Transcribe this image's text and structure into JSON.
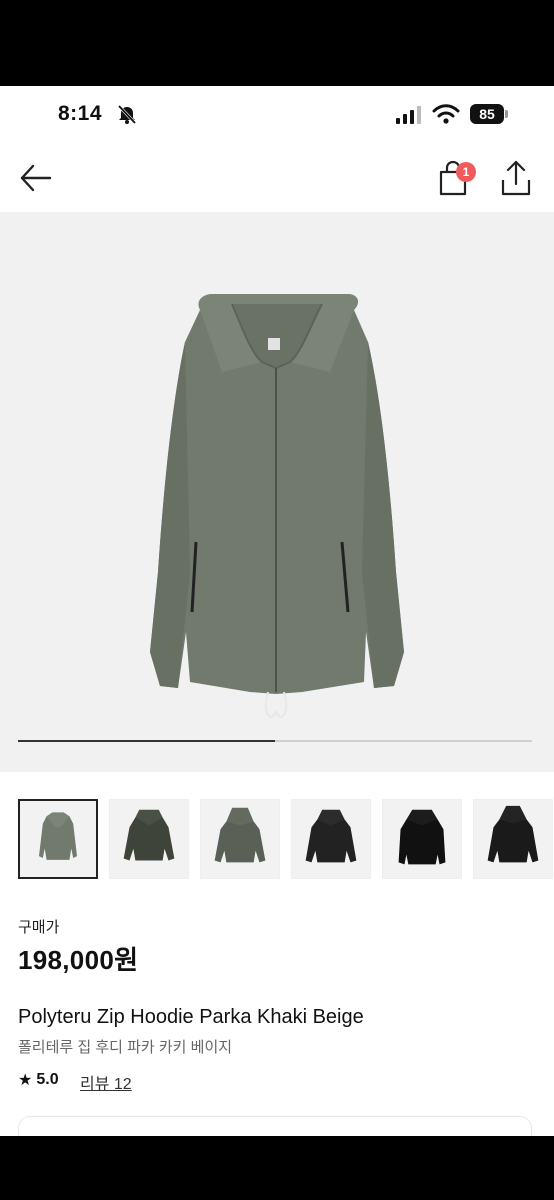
{
  "status_bar": {
    "time": "8:14",
    "battery": "85"
  },
  "nav": {
    "cart_count": "1"
  },
  "gallery": {
    "progress_fraction": 0.5,
    "thumbnail_count": 6
  },
  "product": {
    "price_label": "구매가",
    "price": "198,000원",
    "title_en": "Polyteru Zip Hoodie Parka Khaki Beige",
    "title_ko": "폴리테루 집 후디 파카 카키 베이지",
    "rating": "5.0",
    "review_label": "리뷰 12"
  },
  "colors": {
    "accent_badge": "#f05a5a",
    "jacket_khaki": "#707a6c"
  }
}
